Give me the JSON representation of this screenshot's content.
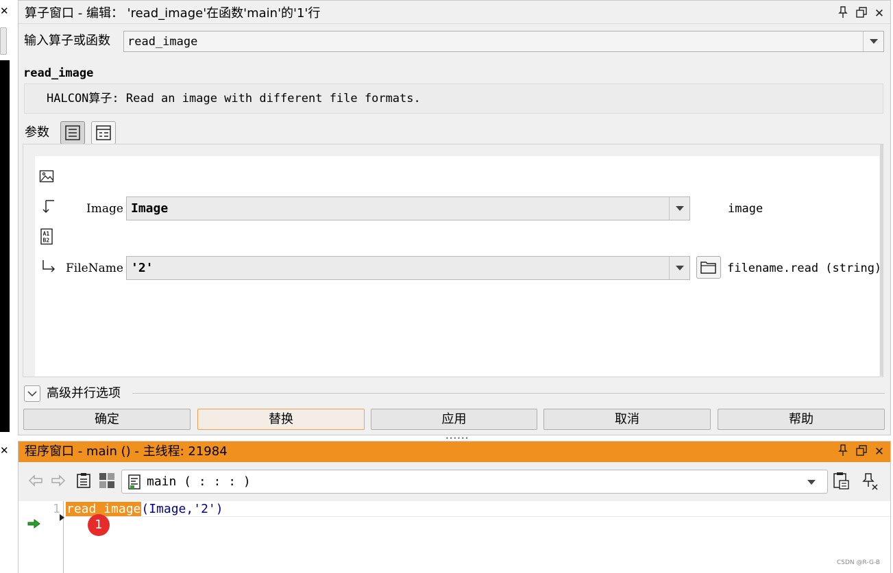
{
  "operator_window": {
    "title": "算子窗口 - 编辑： 'read_image'在函数'main'的'1'行",
    "input_label": "输入算子或函数",
    "input_value": "read_image",
    "operator_name": "read_image",
    "description": "HALCON算子: Read an image with different file formats.",
    "params_label": "参数",
    "params": [
      {
        "kind": "output",
        "label": "Image",
        "value": "Image",
        "type": "image"
      },
      {
        "kind": "input",
        "label": "FileName",
        "value": "'2'",
        "type": "filename.read (string)"
      }
    ],
    "advanced_label": "高级并行选项",
    "buttons": {
      "ok": "确定",
      "replace": "替换",
      "apply": "应用",
      "cancel": "取消",
      "help": "帮助"
    },
    "controls": {
      "pin_icon": "pin-icon",
      "float_icon": "float-window-icon",
      "close_icon": "close-icon"
    }
  },
  "program_window": {
    "title": "程序窗口 - main () - 主线程: 21984",
    "procedure": "main ( : : : )",
    "line_number": "1",
    "code_operator": "read_image",
    "code_args": "(Image,'2')",
    "callout_number": "1"
  },
  "watermark": "CSDN @R-G-B",
  "colors": {
    "accent": "#f0901e",
    "callout": "#e62b2b",
    "code_text": "#00008b"
  }
}
